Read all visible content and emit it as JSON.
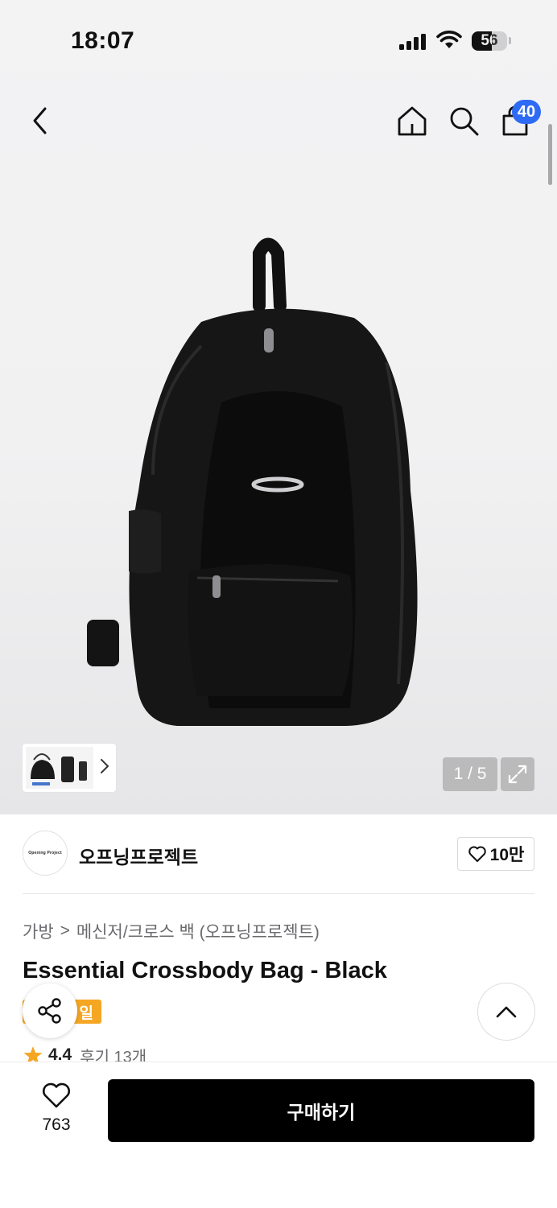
{
  "status_bar": {
    "time": "18:07",
    "battery": "56"
  },
  "header": {
    "cart_count": "40"
  },
  "gallery": {
    "page_indicator": "1 / 5"
  },
  "brand": {
    "logo_text": "Opening Project",
    "name": "오프닝프로젝트",
    "likes": "10만"
  },
  "breadcrumb": {
    "category": "가방",
    "separator": ">",
    "subcategory": "메신저/크로스 백 (오프닝프로젝트)"
  },
  "product": {
    "title": "Essential Crossbody Bag - Black",
    "tag": "일",
    "rating": "4.4",
    "reviews": "후기 13개"
  },
  "bottom_bar": {
    "wish_count": "763",
    "buy_label": "구매하기"
  },
  "colors": {
    "badge_blue": "#2d6bf5",
    "tag_orange": "#f5a623",
    "star": "#f5a623",
    "buy_button": "#000000"
  }
}
